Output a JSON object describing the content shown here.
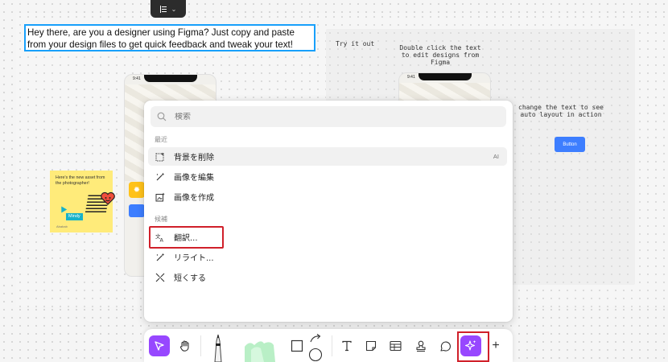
{
  "canvas": {
    "selected_text": "Hey there, are you a designer using Figma? Just copy and paste from your design files to get quick feedback and tweak your text!",
    "try_label": "Try it out",
    "double_click_note": "Double click the text to edit designs from Figma",
    "change_note": "change the text to see auto layout in action",
    "button_label": "Button",
    "phone_time": "9:41",
    "sticky_text": "Here's the new asset from the photographer!",
    "sticky_user": "Mindy",
    "sticky_small": "Ababab"
  },
  "menu": {
    "search_placeholder": "検索",
    "recent_label": "最近",
    "recent_items": [
      {
        "label": "背景を削除",
        "icon": "remove-background-icon",
        "badge": "AI"
      },
      {
        "label": "画像を編集",
        "icon": "edit-image-icon"
      },
      {
        "label": "画像を作成",
        "icon": "create-image-icon"
      }
    ],
    "suggest_label": "候補",
    "suggest_items": [
      {
        "label": "翻訳...",
        "icon": "translate-icon"
      },
      {
        "label": "リライト...",
        "icon": "rewrite-icon"
      },
      {
        "label": "短くする",
        "icon": "shorten-icon"
      }
    ]
  },
  "toolbar": {
    "tools": [
      "move-tool",
      "hand-tool",
      "pen-tool",
      "marker-tool",
      "shape-tool",
      "connector-tool",
      "text-tool",
      "sticky-tool",
      "table-tool",
      "stamp-tool",
      "comment-tool",
      "ai-tool",
      "more-tool"
    ],
    "more_label": "+"
  },
  "colors": {
    "accent_purple": "#9747ff",
    "selection_blue": "#18a0fb",
    "annotation_red": "#d0202a",
    "sticky_yellow": "#ffeb7a"
  }
}
